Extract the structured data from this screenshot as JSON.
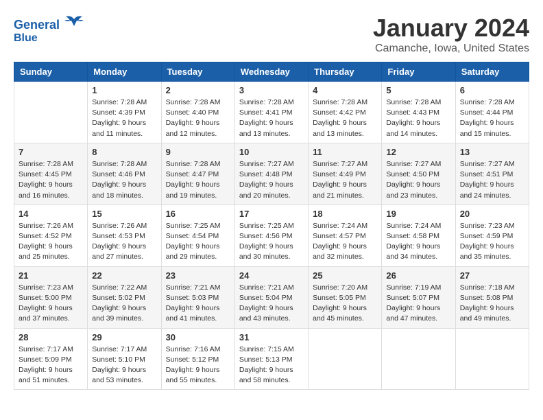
{
  "header": {
    "logo": {
      "line1": "General",
      "line2": "Blue"
    },
    "title": "January 2024",
    "subtitle": "Camanche, Iowa, United States"
  },
  "days_of_week": [
    "Sunday",
    "Monday",
    "Tuesday",
    "Wednesday",
    "Thursday",
    "Friday",
    "Saturday"
  ],
  "weeks": [
    {
      "cells": [
        {
          "day": null
        },
        {
          "day": "1",
          "sunrise": "7:28 AM",
          "sunset": "4:39 PM",
          "daylight": "9 hours and 11 minutes."
        },
        {
          "day": "2",
          "sunrise": "7:28 AM",
          "sunset": "4:40 PM",
          "daylight": "9 hours and 12 minutes."
        },
        {
          "day": "3",
          "sunrise": "7:28 AM",
          "sunset": "4:41 PM",
          "daylight": "9 hours and 13 minutes."
        },
        {
          "day": "4",
          "sunrise": "7:28 AM",
          "sunset": "4:42 PM",
          "daylight": "9 hours and 13 minutes."
        },
        {
          "day": "5",
          "sunrise": "7:28 AM",
          "sunset": "4:43 PM",
          "daylight": "9 hours and 14 minutes."
        },
        {
          "day": "6",
          "sunrise": "7:28 AM",
          "sunset": "4:44 PM",
          "daylight": "9 hours and 15 minutes."
        }
      ]
    },
    {
      "cells": [
        {
          "day": "7",
          "sunrise": "7:28 AM",
          "sunset": "4:45 PM",
          "daylight": "9 hours and 16 minutes."
        },
        {
          "day": "8",
          "sunrise": "7:28 AM",
          "sunset": "4:46 PM",
          "daylight": "9 hours and 18 minutes."
        },
        {
          "day": "9",
          "sunrise": "7:28 AM",
          "sunset": "4:47 PM",
          "daylight": "9 hours and 19 minutes."
        },
        {
          "day": "10",
          "sunrise": "7:27 AM",
          "sunset": "4:48 PM",
          "daylight": "9 hours and 20 minutes."
        },
        {
          "day": "11",
          "sunrise": "7:27 AM",
          "sunset": "4:49 PM",
          "daylight": "9 hours and 21 minutes."
        },
        {
          "day": "12",
          "sunrise": "7:27 AM",
          "sunset": "4:50 PM",
          "daylight": "9 hours and 23 minutes."
        },
        {
          "day": "13",
          "sunrise": "7:27 AM",
          "sunset": "4:51 PM",
          "daylight": "9 hours and 24 minutes."
        }
      ]
    },
    {
      "cells": [
        {
          "day": "14",
          "sunrise": "7:26 AM",
          "sunset": "4:52 PM",
          "daylight": "9 hours and 25 minutes."
        },
        {
          "day": "15",
          "sunrise": "7:26 AM",
          "sunset": "4:53 PM",
          "daylight": "9 hours and 27 minutes."
        },
        {
          "day": "16",
          "sunrise": "7:25 AM",
          "sunset": "4:54 PM",
          "daylight": "9 hours and 29 minutes."
        },
        {
          "day": "17",
          "sunrise": "7:25 AM",
          "sunset": "4:56 PM",
          "daylight": "9 hours and 30 minutes."
        },
        {
          "day": "18",
          "sunrise": "7:24 AM",
          "sunset": "4:57 PM",
          "daylight": "9 hours and 32 minutes."
        },
        {
          "day": "19",
          "sunrise": "7:24 AM",
          "sunset": "4:58 PM",
          "daylight": "9 hours and 34 minutes."
        },
        {
          "day": "20",
          "sunrise": "7:23 AM",
          "sunset": "4:59 PM",
          "daylight": "9 hours and 35 minutes."
        }
      ]
    },
    {
      "cells": [
        {
          "day": "21",
          "sunrise": "7:23 AM",
          "sunset": "5:00 PM",
          "daylight": "9 hours and 37 minutes."
        },
        {
          "day": "22",
          "sunrise": "7:22 AM",
          "sunset": "5:02 PM",
          "daylight": "9 hours and 39 minutes."
        },
        {
          "day": "23",
          "sunrise": "7:21 AM",
          "sunset": "5:03 PM",
          "daylight": "9 hours and 41 minutes."
        },
        {
          "day": "24",
          "sunrise": "7:21 AM",
          "sunset": "5:04 PM",
          "daylight": "9 hours and 43 minutes."
        },
        {
          "day": "25",
          "sunrise": "7:20 AM",
          "sunset": "5:05 PM",
          "daylight": "9 hours and 45 minutes."
        },
        {
          "day": "26",
          "sunrise": "7:19 AM",
          "sunset": "5:07 PM",
          "daylight": "9 hours and 47 minutes."
        },
        {
          "day": "27",
          "sunrise": "7:18 AM",
          "sunset": "5:08 PM",
          "daylight": "9 hours and 49 minutes."
        }
      ]
    },
    {
      "cells": [
        {
          "day": "28",
          "sunrise": "7:17 AM",
          "sunset": "5:09 PM",
          "daylight": "9 hours and 51 minutes."
        },
        {
          "day": "29",
          "sunrise": "7:17 AM",
          "sunset": "5:10 PM",
          "daylight": "9 hours and 53 minutes."
        },
        {
          "day": "30",
          "sunrise": "7:16 AM",
          "sunset": "5:12 PM",
          "daylight": "9 hours and 55 minutes."
        },
        {
          "day": "31",
          "sunrise": "7:15 AM",
          "sunset": "5:13 PM",
          "daylight": "9 hours and 58 minutes."
        },
        {
          "day": null
        },
        {
          "day": null
        },
        {
          "day": null
        }
      ]
    }
  ],
  "labels": {
    "sunrise": "Sunrise:",
    "sunset": "Sunset:",
    "daylight": "Daylight:"
  }
}
